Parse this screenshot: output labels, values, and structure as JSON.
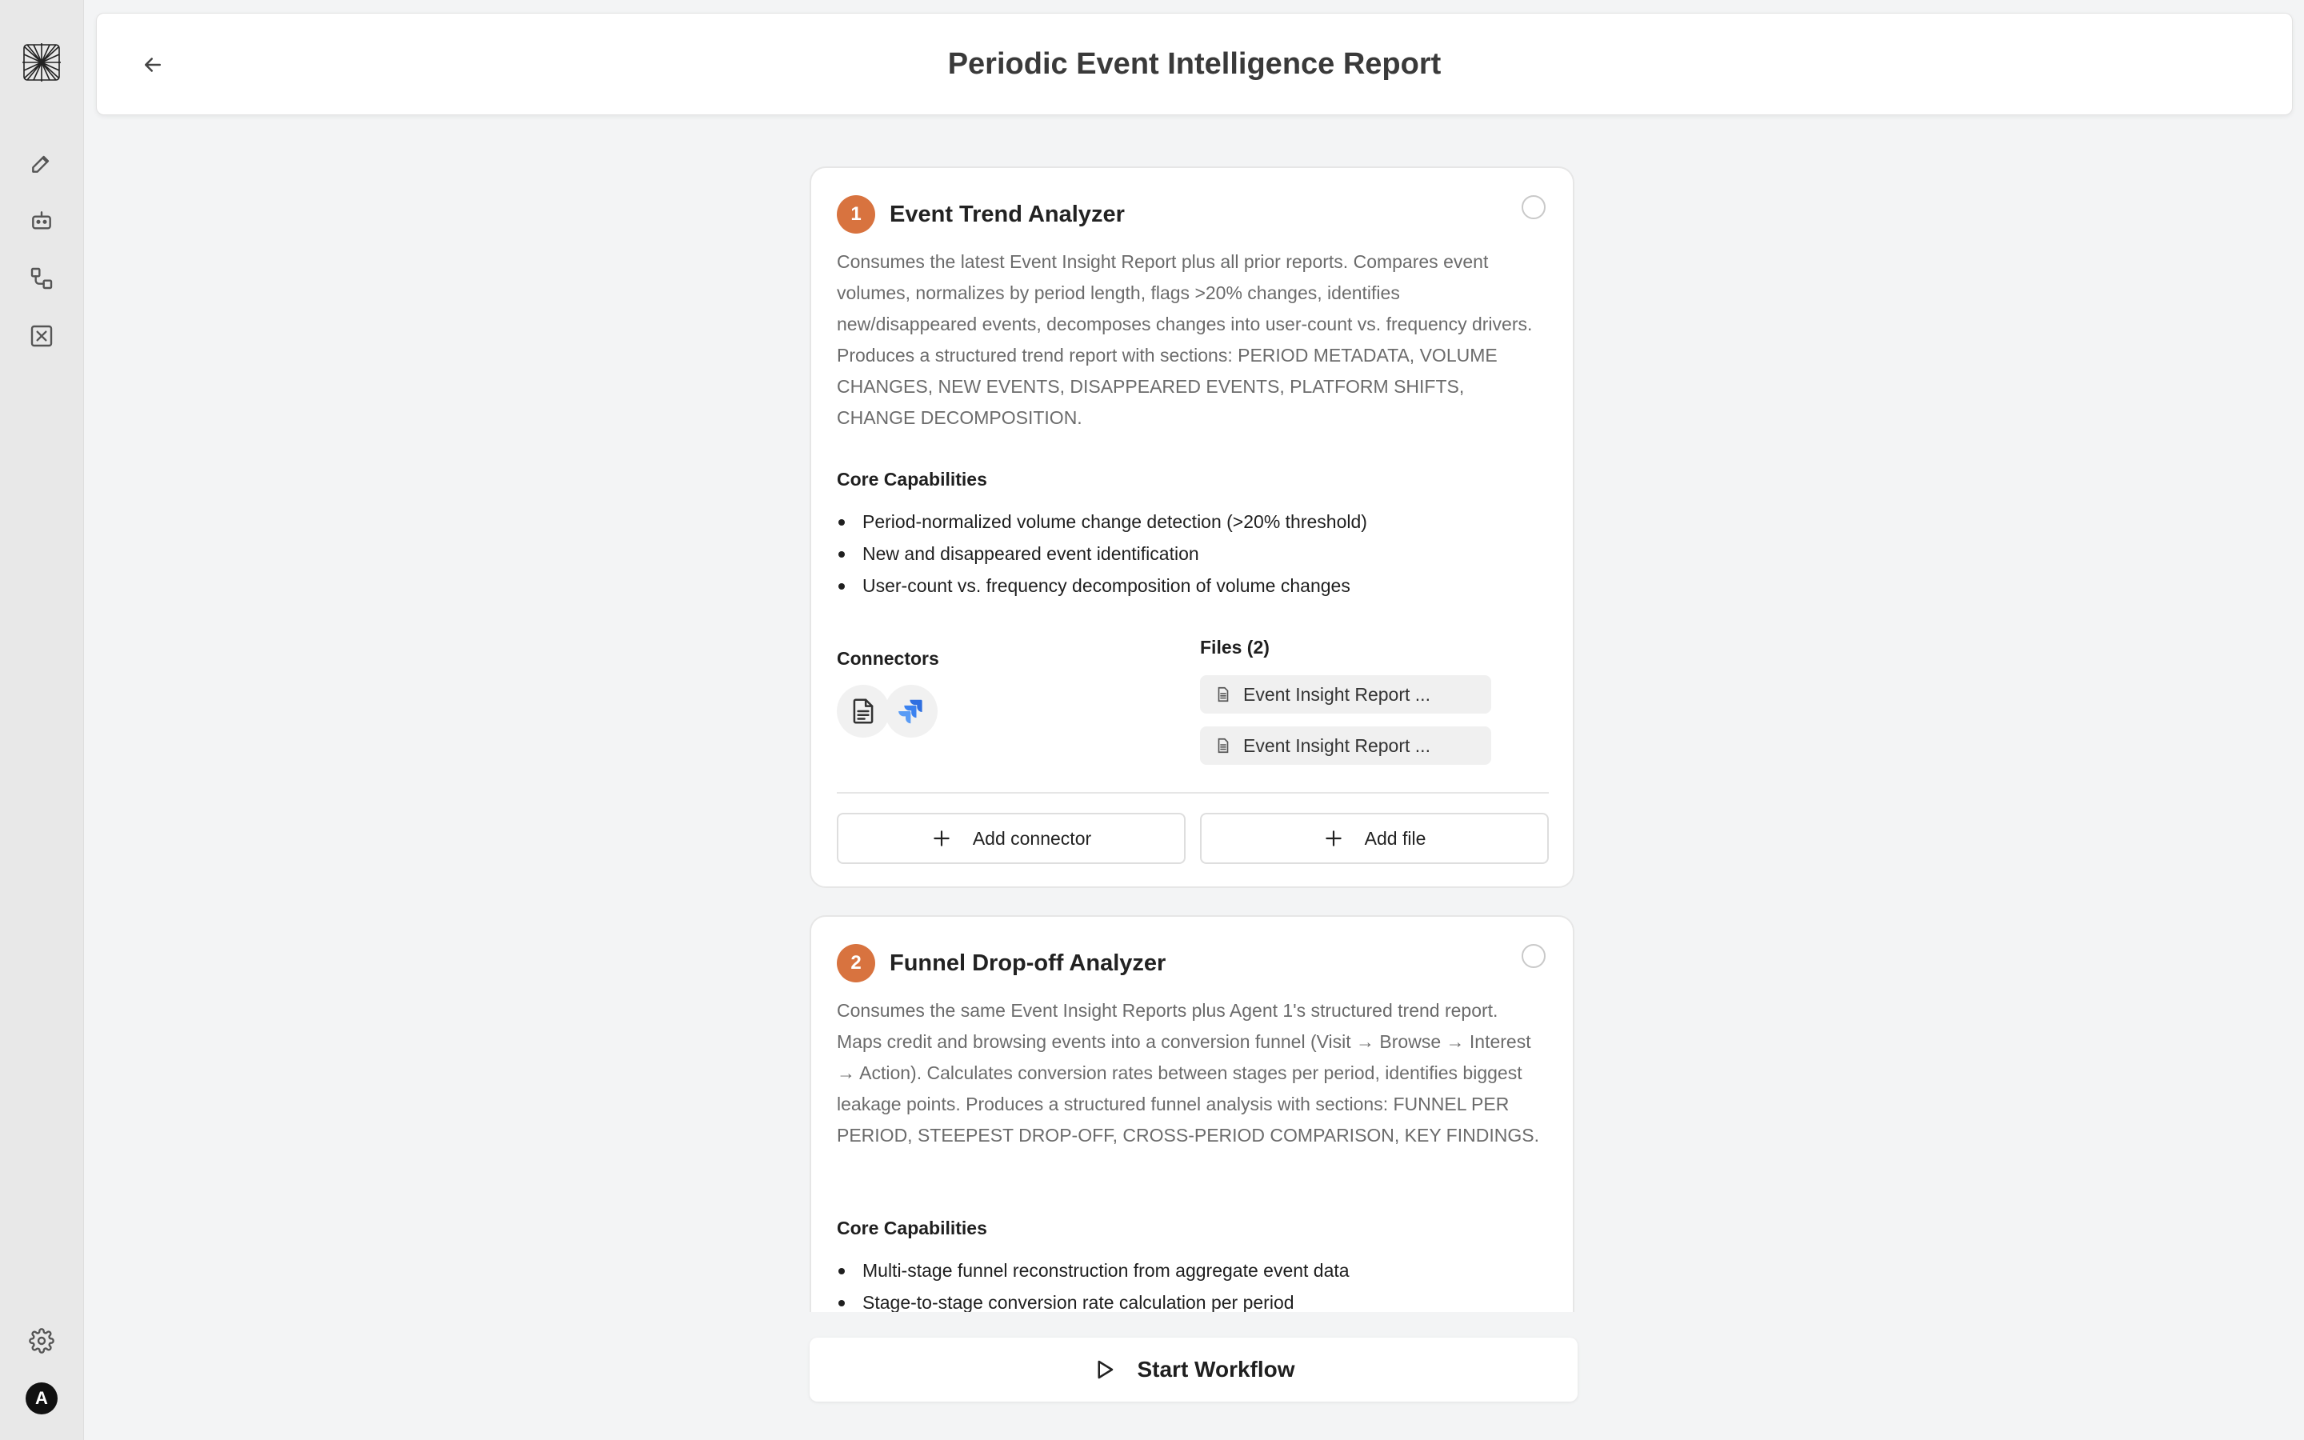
{
  "header": {
    "title": "Periodic Event Intelligence Report"
  },
  "user": {
    "avatar_initial": "A"
  },
  "agents": [
    {
      "number": "1",
      "title": "Event Trend Analyzer",
      "description": "Consumes the latest Event Insight Report plus all prior reports. Compares event volumes, normalizes by period length, flags >20% changes, identifies new/disappeared events, decomposes changes into user-count vs. frequency drivers. Produces a structured trend report with sections: PERIOD METADATA, VOLUME CHANGES, NEW EVENTS, DISAPPEARED EVENTS, PLATFORM SHIFTS, CHANGE DECOMPOSITION.",
      "capabilities_label": "Core Capabilities",
      "capabilities": [
        "Period-normalized volume change detection (>20% threshold)",
        "New and disappeared event identification",
        "User-count vs. frequency decomposition of volume changes"
      ],
      "connectors_label": "Connectors",
      "connectors": [
        "document-icon",
        "jira-icon"
      ],
      "files_label": "Files (2)",
      "files": [
        "Event Insight Report ...",
        "Event Insight Report ..."
      ],
      "add_connector_label": "Add connector",
      "add_file_label": "Add file"
    },
    {
      "number": "2",
      "title": "Funnel Drop-off Analyzer",
      "description": "Consumes the same Event Insight Reports plus Agent 1's structured trend report. Maps credit and browsing events into a conversion funnel (Visit → Browse → Interest → Action). Calculates conversion rates between stages per period, identifies biggest leakage points. Produces a structured funnel analysis with sections: FUNNEL PER PERIOD, STEEPEST DROP-OFF, CROSS-PERIOD COMPARISON, KEY FINDINGS.",
      "capabilities_label": "Core Capabilities",
      "capabilities": [
        "Multi-stage funnel reconstruction from aggregate event data",
        "Stage-to-stage conversion rate calculation per period"
      ]
    }
  ],
  "footer": {
    "start_label": "Start Workflow"
  },
  "colors": {
    "accent": "#d8733f",
    "jira_blue": "#2f6fe0"
  }
}
